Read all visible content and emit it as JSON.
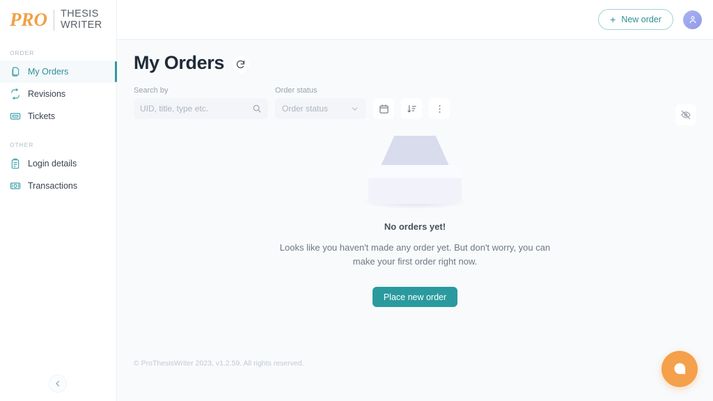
{
  "brand": {
    "logo_pro": "PRO",
    "logo_line1": "THESIS",
    "logo_line2": "WRITER",
    "accent_orange": "#f0a046",
    "accent_teal": "#2a9a9e"
  },
  "topbar": {
    "new_order_label": "New order",
    "new_order_plus": "+",
    "avatar_icon": "user-icon"
  },
  "sidebar": {
    "groups": [
      {
        "label": "ORDER",
        "items": [
          {
            "label": "My Orders",
            "icon": "documents-icon",
            "active": true
          },
          {
            "label": "Revisions",
            "icon": "refresh-arrows-icon",
            "active": false
          },
          {
            "label": "Tickets",
            "icon": "ticket-icon",
            "active": false
          }
        ]
      },
      {
        "label": "OTHER",
        "items": [
          {
            "label": "Login details",
            "icon": "clipboard-icon",
            "active": false
          },
          {
            "label": "Transactions",
            "icon": "banknote-icon",
            "active": false
          }
        ]
      }
    ],
    "collapse_icon": "chevron-left-icon"
  },
  "page": {
    "title": "My Orders",
    "refresh_icon": "refresh-icon"
  },
  "filters": {
    "search_label": "Search by",
    "search_placeholder": "UID, title, type etc.",
    "search_value": "",
    "search_icon": "search-icon",
    "status_label": "Order status",
    "status_value": "Order status",
    "status_chevron": "chevron-down-icon",
    "calendar_icon": "calendar-icon",
    "sort_icon": "sort-descending-icon",
    "more_icon": "kebab-menu-icon",
    "hide_icon": "eye-off-icon"
  },
  "empty_state": {
    "illustration": "empty-inbox-tray",
    "title": "No orders yet!",
    "description": "Looks like you haven't made any order yet. But don't worry, you can make your first order right now.",
    "button_label": "Place new order"
  },
  "footer": {
    "text": "© ProThesisWriter 2023, v1.2.59. All rights reserved."
  },
  "chat": {
    "icon": "chat-bubble-icon"
  }
}
